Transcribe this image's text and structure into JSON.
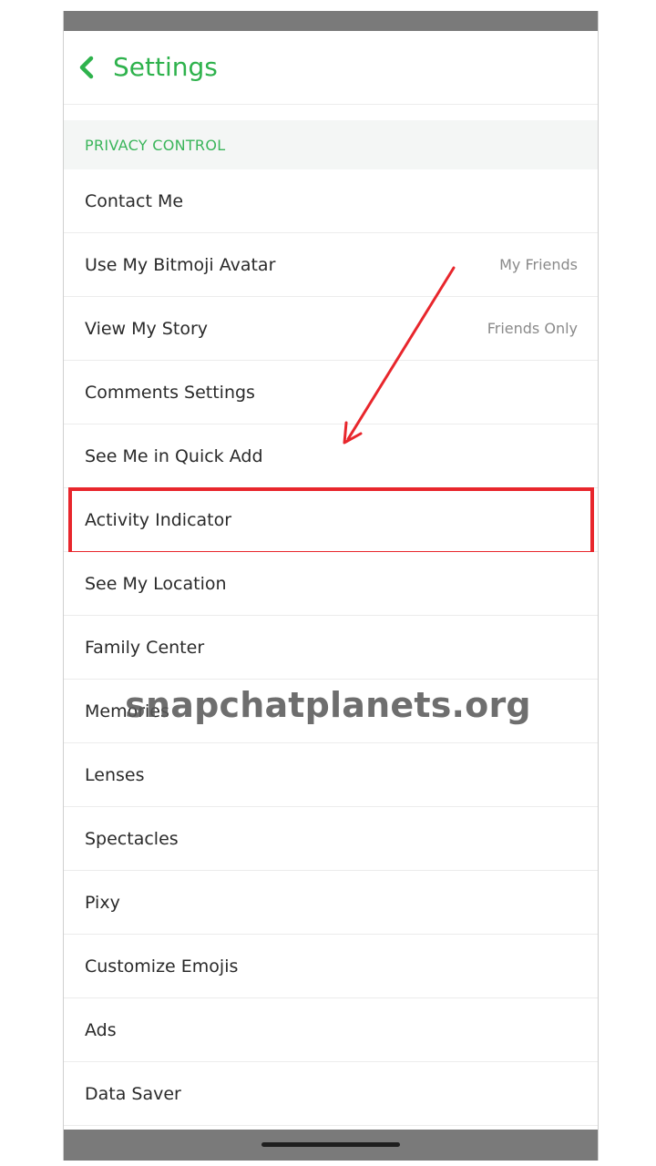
{
  "header": {
    "title": "Settings",
    "back_icon": "chevron-left-icon"
  },
  "section": {
    "title": "PRIVACY CONTROL"
  },
  "rows": [
    {
      "label": "Contact Me",
      "value": ""
    },
    {
      "label": "Use My Bitmoji Avatar",
      "value": "My Friends"
    },
    {
      "label": "View My Story",
      "value": "Friends Only"
    },
    {
      "label": "Comments Settings",
      "value": ""
    },
    {
      "label": "See Me in Quick Add",
      "value": ""
    },
    {
      "label": "Activity Indicator",
      "value": ""
    },
    {
      "label": "See My Location",
      "value": ""
    },
    {
      "label": "Family Center",
      "value": ""
    },
    {
      "label": "Memories",
      "value": ""
    },
    {
      "label": "Lenses",
      "value": ""
    },
    {
      "label": "Spectacles",
      "value": ""
    },
    {
      "label": "Pixy",
      "value": ""
    },
    {
      "label": "Customize Emojis",
      "value": ""
    },
    {
      "label": "Ads",
      "value": ""
    },
    {
      "label": "Data Saver",
      "value": ""
    }
  ],
  "annotation": {
    "highlighted_row": "Activity Indicator",
    "highlight_color": "#e8262c",
    "arrow_color": "#e8262c"
  },
  "watermark": {
    "text": "snapchatplanets.org"
  },
  "colors": {
    "accent": "#2eb24c",
    "section_bg": "#f4f6f5",
    "bar_bg": "#7a7a7a"
  }
}
